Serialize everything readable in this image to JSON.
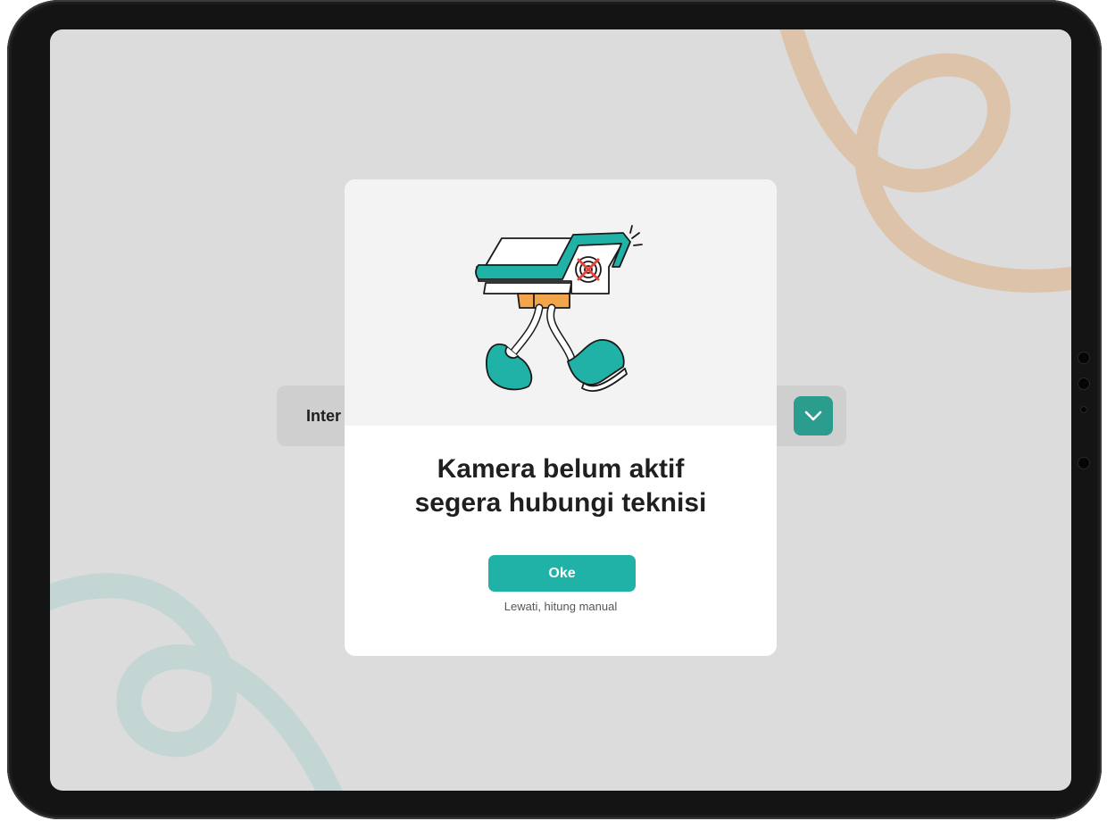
{
  "background": {
    "dropdown_label": "Inter",
    "colors": {
      "screen_bg": "#dcdcdc",
      "swirl_top": "#dcc3aa",
      "swirl_bottom": "#c4d6d3",
      "accent": "#2a9d8f"
    },
    "dropdown_icon": "chevron-down-icon"
  },
  "modal": {
    "illustration": "walking-security-camera-with-red-x-icon",
    "title_line1": "Kamera belum aktif",
    "title_line2": "segera hubungi teknisi",
    "ok_label": "Oke",
    "skip_label": "Lewati, hitung manual",
    "colors": {
      "button": "#20b2a6",
      "illustration_bg": "#f3f3f3"
    }
  }
}
